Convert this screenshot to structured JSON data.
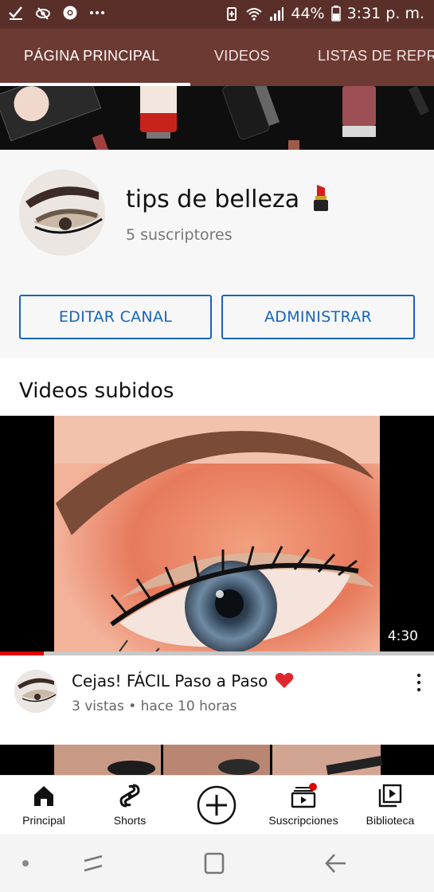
{
  "status_bar": {
    "battery": "44%",
    "time": "3:31 p. m.",
    "left_icons": [
      "check-download-icon",
      "eye-icon",
      "chrome-icon",
      "more-dots-icon"
    ],
    "right_icons": [
      "battery-saver-icon",
      "wifi-icon",
      "signal-icon",
      "battery-icon"
    ]
  },
  "tabs": {
    "items": [
      {
        "label": "PÁGINA PRINCIPAL",
        "active": true
      },
      {
        "label": "VIDEOS",
        "active": false
      },
      {
        "label": "LISTAS DE REPR",
        "active": false
      }
    ]
  },
  "channel": {
    "name": "tips de belleza",
    "name_emoji": "lipstick-icon",
    "subscribers": "5 suscriptores",
    "edit_button": "EDITAR CANAL",
    "admin_button": "ADMINISTRAR"
  },
  "section": {
    "title": "Videos subidos"
  },
  "video": {
    "duration": "4:30",
    "watched_fraction": 0.1,
    "title": "Cejas! FÁCIL Paso a Paso",
    "title_emoji": "heart-icon",
    "meta": "3 vistas • hace 10 horas"
  },
  "bottom_nav": {
    "items": [
      {
        "label": "Principal",
        "icon": "home-icon"
      },
      {
        "label": "Shorts",
        "icon": "shorts-icon"
      },
      {
        "label": "",
        "icon": "create-plus-icon"
      },
      {
        "label": "Suscripciones",
        "icon": "subscriptions-icon"
      },
      {
        "label": "Biblioteca",
        "icon": "library-icon"
      }
    ]
  },
  "colors": {
    "status_bar": "#5a2f2a",
    "tab_bar": "#6d3a33",
    "accent_blue": "#1565c0",
    "progress_red": "#e00000"
  }
}
